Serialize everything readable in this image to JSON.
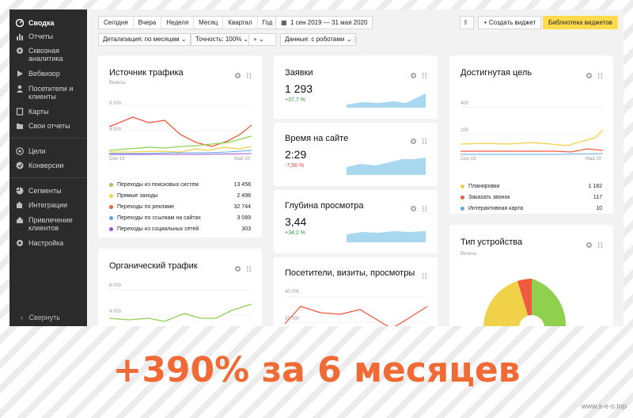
{
  "sidebar": {
    "items": [
      {
        "label": "Сводка",
        "icon": "dashboard-icon"
      },
      {
        "label": "Отчеты",
        "icon": "bar-chart-icon"
      },
      {
        "label": "Сквозная аналитика",
        "icon": "gear-analytics-icon"
      },
      {
        "label": "Вебвизор",
        "icon": "play-icon"
      },
      {
        "label": "Посетители и клиенты",
        "icon": "user-icon"
      },
      {
        "label": "Карты",
        "icon": "map-icon"
      },
      {
        "label": "Свои отчеты",
        "icon": "folder-icon"
      },
      {
        "label": "Цели",
        "icon": "target-icon"
      },
      {
        "label": "Конверсии",
        "icon": "conversion-icon"
      },
      {
        "label": "Сегменты",
        "icon": "pie-icon"
      },
      {
        "label": "Интеграции",
        "icon": "puzzle-icon"
      },
      {
        "label": "Привлечение клиентов",
        "icon": "house-icon"
      },
      {
        "label": "Настройка",
        "icon": "settings-icon"
      }
    ],
    "collapse_label": "Свернуть"
  },
  "toolbar": {
    "periods": [
      "Сегодня",
      "Вчера",
      "Неделя",
      "Месяц",
      "Квартал",
      "Год"
    ],
    "date_range": "1 сен 2019 — 31 мая 2020",
    "create_widget": "+ Создать виджет",
    "widget_library": "Библиотека виджетов",
    "detail": "Детализация: по месяцам",
    "accuracy": "Точность: 100%",
    "data": "Данные: с роботами"
  },
  "traffic_source": {
    "title": "Источник трафика",
    "subtitle": "Визиты",
    "y_ticks": [
      "8 000",
      "4 000"
    ],
    "x_ticks": [
      "Сен 19",
      "Май 20"
    ],
    "legend": [
      {
        "label": "Переходы из поисковых систем",
        "value": "13 458",
        "color": "#8fd14f"
      },
      {
        "label": "Прямые заходы",
        "value": "2 498",
        "color": "#f2d14a"
      },
      {
        "label": "Переходы по рекламе",
        "value": "32 744",
        "color": "#ef5b3c"
      },
      {
        "label": "Переходы по ссылкам на сайтах",
        "value": "3 089",
        "color": "#5aa7e6"
      },
      {
        "label": "Переходы из социальных сетей",
        "value": "303",
        "color": "#9b4dd9"
      }
    ]
  },
  "organic": {
    "title": "Органический трафик",
    "y_ticks": [
      "8 000",
      "4 000"
    ]
  },
  "requests": {
    "title": "Заявки",
    "value": "1 293",
    "delta": "+37,7 %"
  },
  "time_on_site": {
    "title": "Время на сайте",
    "value": "2:29",
    "delta": "-7,56 %"
  },
  "depth": {
    "title": "Глубина просмотра",
    "value": "3,44",
    "delta": "+34,2 %"
  },
  "visitors": {
    "title": "Посетители, визиты, просмотры",
    "y_ticks": [
      "40 000",
      "20 000"
    ]
  },
  "goal": {
    "title": "Достигнутая цель",
    "y_ticks": [
      "400",
      "200"
    ],
    "x_ticks": [
      "Сен 19",
      "Май 20"
    ],
    "legend": [
      {
        "label": "Планировки",
        "value": "1 182",
        "color": "#f2d14a"
      },
      {
        "label": "Заказать звонок",
        "value": "117",
        "color": "#ef5b3c"
      },
      {
        "label": "Интерактивная карта",
        "value": "10",
        "color": "#5aa7e6"
      }
    ]
  },
  "device": {
    "title": "Тип устройства",
    "subtitle": "Визиты"
  },
  "caption": "+390% за 6 месяцев",
  "watermark": "www.s-e-o.top"
}
